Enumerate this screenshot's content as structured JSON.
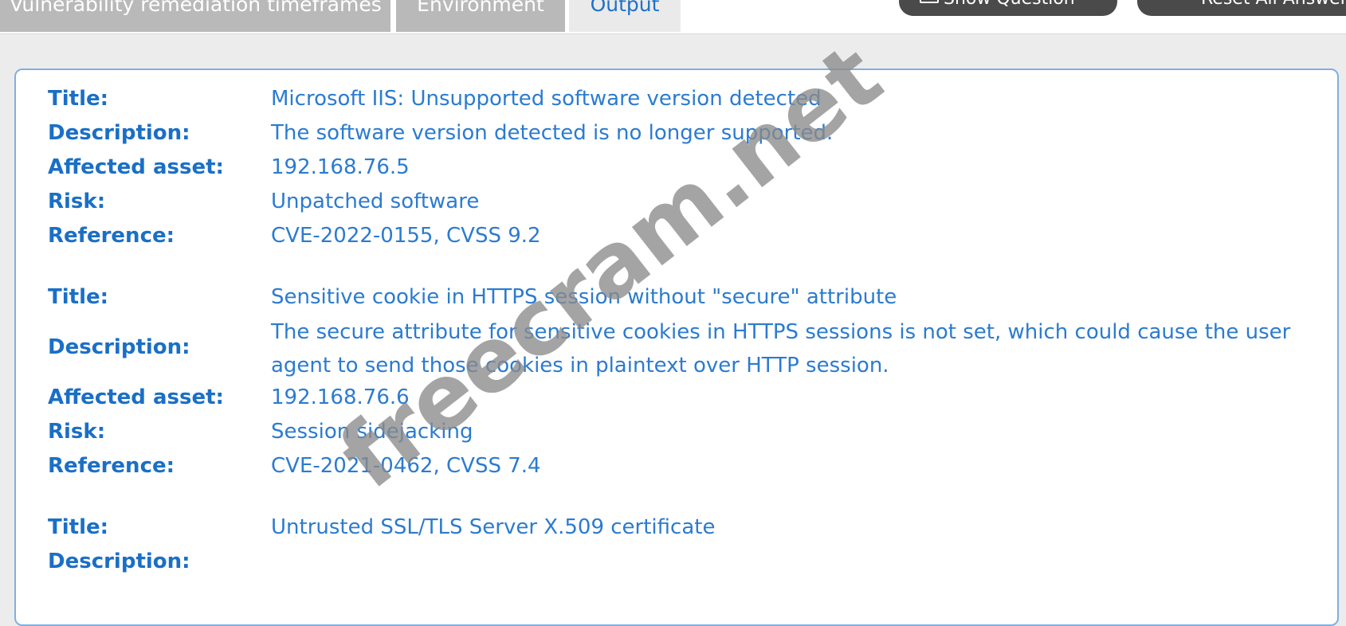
{
  "tabs": [
    {
      "label": "Vulnerability remediation timeframes",
      "active": false
    },
    {
      "label": "Environment",
      "active": false
    },
    {
      "label": "Output",
      "active": true
    }
  ],
  "toolbar": {
    "show_question_label": "Show Question",
    "reset_answers_label": "Reset All Answers"
  },
  "findings": [
    {
      "title_label": "Title:",
      "title": "Microsoft IIS: Unsupported software version detected",
      "description_label": "Description:",
      "description": "The software version detected is no longer supported.",
      "asset_label": "Affected asset:",
      "asset": "192.168.76.5",
      "risk_label": "Risk:",
      "risk": "Unpatched software",
      "reference_label": "Reference:",
      "reference": "CVE-2022-0155, CVSS 9.2"
    },
    {
      "title_label": "Title:",
      "title": "Sensitive cookie in HTTPS session without \"secure\" attribute",
      "description_label": "Description:",
      "description": "The secure attribute for sensitive cookies in HTTPS sessions is not set, which could cause the user agent to send those cookies in plaintext over HTTP session.",
      "asset_label": "Affected asset:",
      "asset": "192.168.76.6",
      "risk_label": "Risk:",
      "risk": "Session sidejacking",
      "reference_label": "Reference:",
      "reference": "CVE-2021-0462, CVSS 7.4"
    },
    {
      "title_label": "Title:",
      "title": "Untrusted SSL/TLS Server X.509 certificate",
      "description_label": "Description:"
    }
  ],
  "watermark": {
    "text": "freecram.net"
  },
  "colors": {
    "label": "#1a6fc6",
    "value": "#2b7bd0",
    "panel_border": "#7fb0e0",
    "background": "#ececec",
    "tab_inactive": "#b9b9b9",
    "pill": "#4a4a4a"
  },
  "icons": {
    "show_question": "keyboard-icon",
    "reset_answers": "reset-icon"
  }
}
